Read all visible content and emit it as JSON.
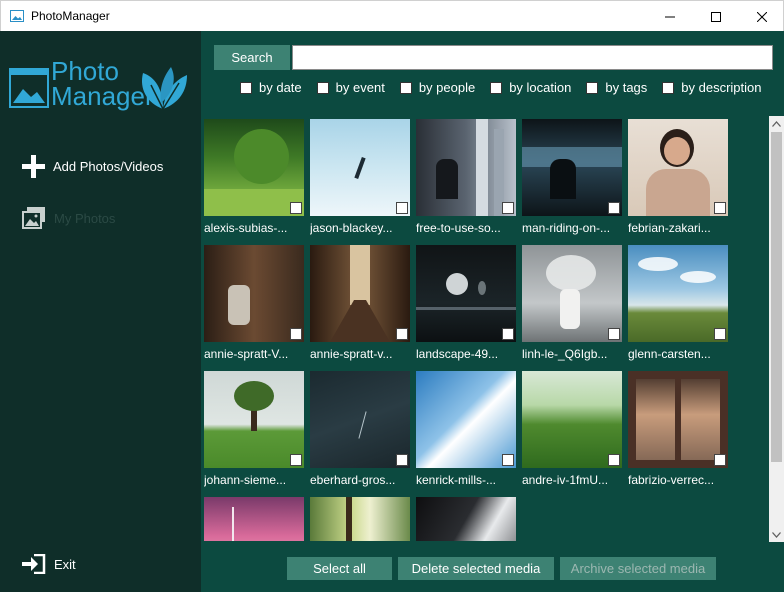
{
  "window": {
    "title": "PhotoManager"
  },
  "logo": {
    "line1": "Photo",
    "line2": "Manager"
  },
  "sidebar": {
    "add_label": "Add Photos/Videos",
    "my_photos_label": "My Photos",
    "exit_label": "Exit"
  },
  "search": {
    "button_label": "Search",
    "value": ""
  },
  "filters": [
    "by date",
    "by event",
    "by people",
    "by location",
    "by tags",
    "by description"
  ],
  "photos": [
    "alexis-subias-...",
    "jason-blackey...",
    "free-to-use-so...",
    "man-riding-on-...",
    "febrian-zakari...",
    "annie-spratt-V...",
    "annie-spratt-v...",
    "landscape-49...",
    "linh-le-_Q6Igb...",
    "glenn-carsten...",
    "johann-sieme...",
    "eberhard-gros...",
    "kenrick-mills-...",
    "andre-iv-1fmU...",
    "fabrizio-verrec...",
    "",
    "",
    ""
  ],
  "actions": {
    "select_all": "Select all",
    "delete_selected": "Delete selected media",
    "archive_selected": "Archive selected media"
  },
  "colors": {
    "sidebar_bg": "#0f2e29",
    "main_bg": "#0c4a40",
    "button_bg": "#3d8273",
    "logo_blue": "#31a8d6"
  }
}
